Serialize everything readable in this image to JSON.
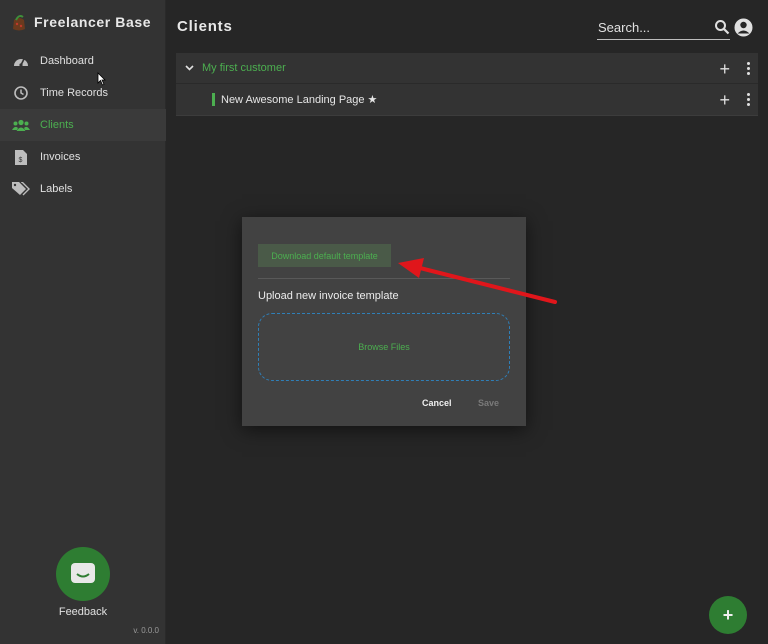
{
  "app": {
    "name": "Freelancer Base",
    "version": "v. 0.0.0"
  },
  "sidebar": {
    "items": [
      {
        "label": "Dashboard",
        "icon": "dashboard-gauge-icon",
        "active": false
      },
      {
        "label": "Time Records",
        "icon": "clock-icon",
        "active": false
      },
      {
        "label": "Clients",
        "icon": "users-icon",
        "active": true
      },
      {
        "label": "Invoices",
        "icon": "invoice-icon",
        "active": false
      },
      {
        "label": "Labels",
        "icon": "tags-icon",
        "active": false
      }
    ],
    "feedback_label": "Feedback"
  },
  "header": {
    "title": "Clients",
    "search_placeholder": "Search..."
  },
  "clients": [
    {
      "name": "My first customer",
      "projects": [
        {
          "name": "New Awesome Landing Page ★"
        }
      ]
    }
  ],
  "dialog": {
    "download_label": "Download default template",
    "upload_label": "Upload new invoice template",
    "browse_label": "Browse Files",
    "cancel_label": "Cancel",
    "save_label": "Save"
  },
  "fab_label": "+",
  "colors": {
    "accent": "#4caf50",
    "accent_dark": "#2e7d32",
    "annotation_arrow": "#e0161b",
    "dropzone_border": "#2f7fb8"
  }
}
